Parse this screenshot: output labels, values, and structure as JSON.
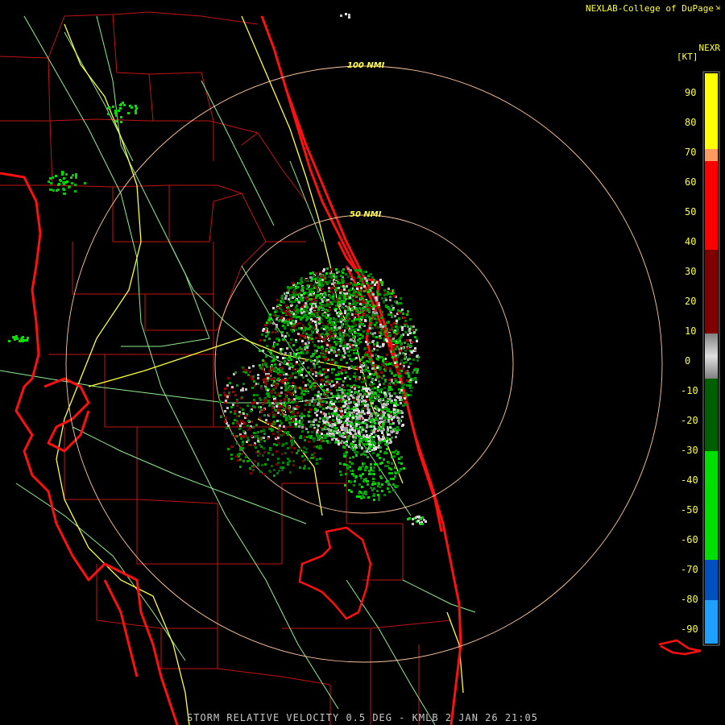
{
  "header": {
    "credit": "NEXLAB-College of DuPage",
    "credit_icon": "corner-arrow-icon",
    "product": "NEXR",
    "units": "[KT]"
  },
  "footer": {
    "title": "STORM RELATIVE VELOCITY 0.5 DEG - KMLB 2 JAN 26 21:05"
  },
  "rings": [
    {
      "label": "100 NMI"
    },
    {
      "label": "50 NMI"
    }
  ],
  "color_scale": {
    "ticks": [
      "90",
      "80",
      "70",
      "60",
      "50",
      "40",
      "30",
      "20",
      "10",
      "0",
      "-10",
      "-20",
      "-30",
      "-40",
      "-50",
      "-60",
      "-70",
      "-80",
      "-90"
    ],
    "colors": {
      "top": "#ffff00",
      "upper": "#ff9a60",
      "red": "#ff0000",
      "dark_red": "#800000",
      "gray": "#c0c0c0",
      "dark_green": "#006000",
      "green": "#00e000",
      "blue": "#0050c0",
      "cyan": "#1ea0ff"
    }
  },
  "map_colors": {
    "coast": "#ff1010",
    "counties": "#c01414",
    "highways": "#ffff40",
    "roads": "#90ee90",
    "rings": "#ffc8a0"
  }
}
